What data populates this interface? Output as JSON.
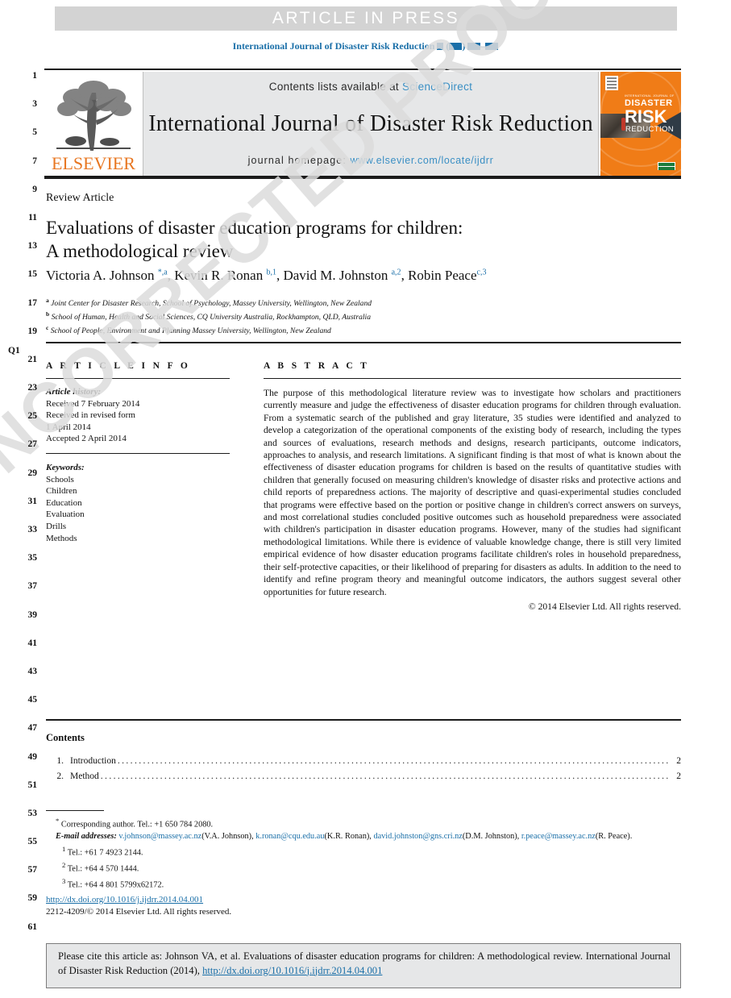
{
  "banner": {
    "text": "ARTICLE IN PRESS"
  },
  "running_head": {
    "prefix": "International Journal of Disaster Risk Reduction"
  },
  "masthead": {
    "publisher_logo_text": "ELSEVIER",
    "contents_prefix": "Contents lists available at",
    "contents_link": "ScienceDirect",
    "journal_title": "International Journal of Disaster Risk Reduction",
    "homepage_prefix": "journal homepage:",
    "homepage_link": "www.elsevier.com/locate/ijdrr",
    "cover": {
      "tagline": "INTERNATIONAL JOURNAL OF",
      "line1": "DISASTER",
      "line2": "RISK",
      "line3": "REDUCTION"
    }
  },
  "article": {
    "type": "Review Article",
    "title_line1": "Evaluations of disaster education programs for children:",
    "title_line2": "A methodological review",
    "authors_html": "Victoria A. Johnson <sup>*,a</sup>, Kevin R. Ronan <sup>b,1</sup>, David M. Johnston <sup>a,2</sup>, Robin Peace<sup>c,3</sup>",
    "affiliations": [
      {
        "marker": "a",
        "text": "Joint Center for Disaster Research, School of Psychology, Massey University, Wellington, New Zealand"
      },
      {
        "marker": "b",
        "text": "School of Human, Health and Social Sciences, CQ University Australia, Rockhampton, QLD, Australia"
      },
      {
        "marker": "c",
        "text": "School of People, Environment and Planning Massey University, Wellington, New Zealand"
      }
    ]
  },
  "article_info": {
    "heading": "A R T I C L E   I N F O",
    "history_label": "Article history:",
    "history_lines": [
      "Received 7 February 2014",
      "Received in revised form",
      "1 April 2014",
      "Accepted 2 April 2014"
    ],
    "keywords_label": "Keywords:",
    "keywords": [
      "Schools",
      "Children",
      "Education",
      "Evaluation",
      "Drills",
      "Methods"
    ]
  },
  "abstract": {
    "heading": "A B S T R A C T",
    "body": "The purpose of this methodological literature review was to investigate how scholars and practitioners currently measure and judge the effectiveness of disaster education programs for children through evaluation. From a systematic search of the published and gray literature, 35 studies were identified and analyzed to develop a categorization of the operational components of the existing body of research, including the types and sources of evaluations, research methods and designs, research participants, outcome indicators, approaches to analysis, and research limitations. A significant finding is that most of what is known about the effectiveness of disaster education programs for children is based on the results of quantitative studies with children that generally focused on measuring children's knowledge of disaster risks and protective actions and child reports of preparedness actions. The majority of descriptive and quasi-experimental studies concluded that programs were effective based on the portion or positive change in children's correct answers on surveys, and most correlational studies concluded positive outcomes such as household preparedness were associated with children's participation in disaster education programs. However, many of the studies had significant methodological limitations. While there is evidence of valuable knowledge change, there is still very limited empirical evidence of how disaster education programs facilitate children's roles in household preparedness, their self-protective capacities, or their likelihood of preparing for disasters as adults. In addition to the need to identify and refine program theory and meaningful outcome indicators, the authors suggest several other opportunities for future research.",
    "copyright": "© 2014 Elsevier Ltd. All rights reserved."
  },
  "contents": {
    "heading": "Contents",
    "items": [
      {
        "number": "1.",
        "label": "Introduction",
        "page": "2"
      },
      {
        "number": "2.",
        "label": "Method",
        "page": "2"
      }
    ]
  },
  "footnotes": {
    "corresponding": "Corresponding author. Tel.: +1 650 784 2080.",
    "email_label": "E-mail addresses:",
    "emails": [
      {
        "address": "v.johnson@massey.ac.nz",
        "owner": "(V.A. Johnson)"
      },
      {
        "address": "k.ronan@cqu.edu.au",
        "owner": "(K.R. Ronan)"
      },
      {
        "address": "david.johnston@gns.cri.nz",
        "owner": "(D.M. Johnston)"
      },
      {
        "address": "r.peace@massey.ac.nz",
        "owner": "(R. Peace)."
      }
    ],
    "numbered": [
      {
        "marker": "1",
        "text": "Tel.: +61 7 4923 2144."
      },
      {
        "marker": "2",
        "text": "Tel.: +64 4 570 1444."
      },
      {
        "marker": "3",
        "text": "Tel.: +64 4 801 5799x62172."
      }
    ]
  },
  "doi_block": {
    "doi_url": "http://dx.doi.org/10.1016/j.ijdrr.2014.04.001",
    "issn_line": "2212-4209/© 2014 Elsevier Ltd. All rights reserved."
  },
  "citation_box": {
    "text_before": "Please cite this article as: Johnson VA, et al. Evaluations of disaster education programs for children: A methodological review. International Journal of Disaster Risk Reduction (2014),",
    "link": "http://dx.doi.org/10.1016/j.ijdrr.2014.04.001"
  },
  "watermark": {
    "text": "UNCORRECTED PROOF"
  },
  "line_numbers": {
    "query_marker": "Q1",
    "values": [
      "1",
      "3",
      "5",
      "7",
      "9",
      "11",
      "13",
      "15",
      "17",
      "19",
      "21",
      "23",
      "25",
      "27",
      "29",
      "31",
      "33",
      "35",
      "37",
      "39",
      "41",
      "43",
      "45",
      "47",
      "49",
      "51",
      "53",
      "55",
      "57",
      "59",
      "61"
    ]
  }
}
